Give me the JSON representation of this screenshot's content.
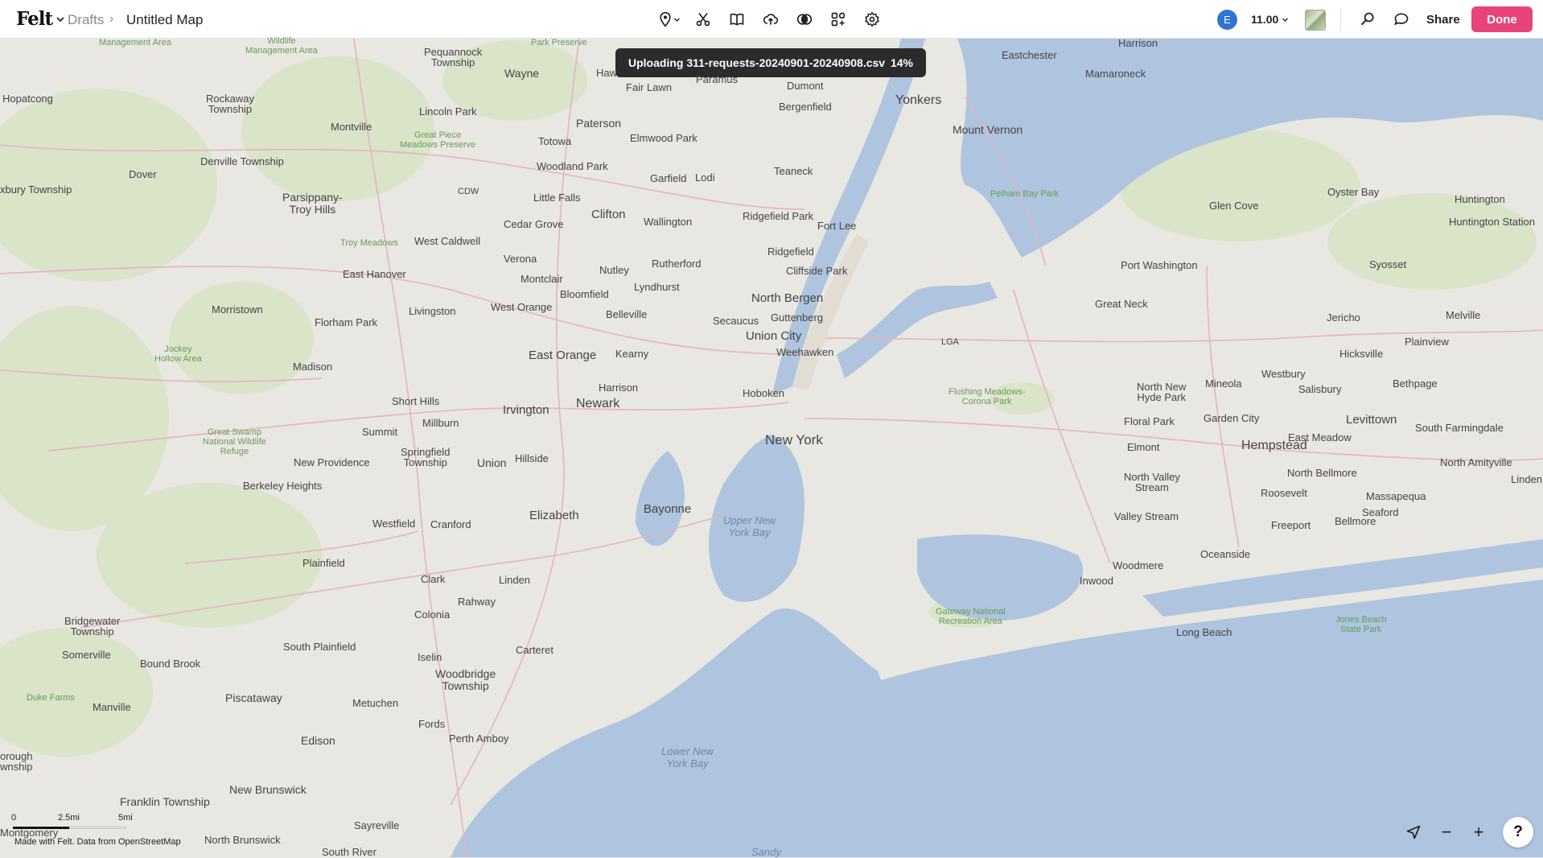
{
  "header": {
    "logo": "Felt",
    "breadcrumb_parent": "Drafts",
    "breadcrumb_sep": "›",
    "map_title": "Untitled Map",
    "avatar_initial": "E",
    "zoom_level": "11.00",
    "share_label": "Share",
    "done_label": "Done"
  },
  "toolbar": [
    {
      "name": "pin-tool",
      "icon": "map-pin-icon"
    },
    {
      "name": "route-tool",
      "icon": "scissors-icon"
    },
    {
      "name": "library-tool",
      "icon": "book-icon"
    },
    {
      "name": "upload-tool",
      "icon": "cloud-upload-icon"
    },
    {
      "name": "compare-tool",
      "icon": "circles-icon"
    },
    {
      "name": "elements-tool",
      "icon": "grid-plus-icon"
    },
    {
      "name": "settings-tool",
      "icon": "gear-icon"
    }
  ],
  "toast": {
    "text": "Uploading 311-requests-20240901-20240908.csv",
    "percent": "14%"
  },
  "map_labels": {
    "new_york": "New York",
    "newark": "Newark",
    "yonkers": "Yonkers",
    "mount_vernon": "Mount Vernon",
    "hempstead": "Hempstead",
    "levittown": "Levittown",
    "east_orange": "East Orange",
    "paterson": "Paterson",
    "clifton": "Clifton",
    "union_city": "Union City",
    "north_bergen": "North Bergen",
    "hoboken": "Hoboken",
    "elizabeth": "Elizabeth",
    "bayonne": "Bayonne",
    "irvington": "Irvington",
    "wayne": "Wayne",
    "lincoln_park": "Lincoln Park",
    "montville": "Montville",
    "denville": "Denville Township",
    "parsippany": "Parsippany-\nTroy Hills",
    "dover": "Dover",
    "morristown": "Morristown",
    "madison": "Madison",
    "florham_park": "Florham Park",
    "livingston": "Livingston",
    "east_hanover": "East Hanover",
    "west_caldwell": "West Caldwell",
    "verona": "Verona",
    "montclair": "Montclair",
    "bloomfield": "Bloomfield",
    "west_orange": "West Orange",
    "nutley": "Nutley",
    "lyndhurst": "Lyndhurst",
    "rutherford": "Rutherford",
    "belleville": "Belleville",
    "kearny": "Kearny",
    "harrison": "Harrison",
    "secaucus": "Secaucus",
    "guttenberg": "Guttenberg",
    "weehawken": "Weehawken",
    "cliffside_park": "Cliffside Park",
    "ridgefield": "Ridgefield",
    "ridgefield_park": "Ridgefield Park",
    "fort_lee": "Fort Lee",
    "teaneck": "Teaneck",
    "bergenfield": "Bergenfield",
    "dumont": "Dumont",
    "fair_lawn": "Fair Lawn",
    "elmwood_park": "Elmwood Park",
    "garfield": "Garfield",
    "lodi": "Lodi",
    "wallington": "Wallington",
    "totowa": "Totowa",
    "woodland_park": "Woodland Park",
    "little_falls": "Little Falls",
    "cedar_grove": "Cedar Grove",
    "pequannock": "Pequannock\nTownship",
    "rockaway": "Rockaway\nTownship",
    "hopatcong": "Hopatcong",
    "roxbury": "xbury Township",
    "short_hills": "Short Hills",
    "millburn": "Millburn",
    "summit": "Summit",
    "springfield": "Springfield\nTownship",
    "union": "Union",
    "hillside": "Hillside",
    "new_providence": "New Providence",
    "berkeley_heights": "Berkeley Heights",
    "westfield": "Westfield",
    "cranford": "Cranford",
    "plainfield": "Plainfield",
    "clark": "Clark",
    "linden": "Linden",
    "rahway": "Rahway",
    "colonia": "Colonia",
    "carteret": "Carteret",
    "iselin": "Iselin",
    "woodbridge": "Woodbridge\nTownship",
    "metuchen": "Metuchen",
    "fords": "Fords",
    "perth_amboy": "Perth Amboy",
    "edison": "Edison",
    "piscataway": "Piscataway",
    "south_plainfield": "South Plainfield",
    "bound_brook": "Bound Brook",
    "somerville": "Somerville",
    "bridgewater": "Bridgewater\nTownship",
    "manville": "Manville",
    "new_brunswick": "New Brunswick",
    "franklin_township": "Franklin Township",
    "sayreville": "Sayreville",
    "north_brunswick": "North Brunswick",
    "south_river": "South River",
    "hillsborough": "orough\nwnship",
    "montgomery": "Montgomery",
    "eastchester": "Eastchester",
    "mamaroneck": "Mamaroneck",
    "harrison_ny": "Harrison",
    "glen_cove": "Glen Cove",
    "oyster_bay": "Oyster Bay",
    "huntington": "Huntington",
    "huntington_station": "Huntington Station",
    "syosset": "Syosset",
    "port_washington": "Port Washington",
    "great_neck": "Great Neck",
    "jericho": "Jericho",
    "melville": "Melville",
    "plainview": "Plainview",
    "hicksville": "Hicksville",
    "westbury": "Westbury",
    "salisbury": "Salisbury",
    "mineola": "Mineola",
    "north_new_hyde_park": "North New\nHyde Park",
    "bethpage": "Bethpage",
    "garden_city": "Garden City",
    "floral_park": "Floral Park",
    "east_meadow": "East Meadow",
    "south_farmingdale": "South Farmingdale",
    "elmont": "Elmont",
    "north_valley_stream": "North Valley\nStream",
    "north_bellmore": "North Bellmore",
    "north_amityville": "North Amityville",
    "lindenhurst": "Linden",
    "roosevelt": "Roosevelt",
    "massapequa": "Massapequa",
    "seaford": "Seaford",
    "valley_stream": "Valley Stream",
    "freeport": "Freeport",
    "bellmore": "Bellmore",
    "oceanside": "Oceanside",
    "woodmere": "Woodmere",
    "inwood": "Inwood",
    "long_beach": "Long Beach",
    "lga": "LGA",
    "cdw": "CDW",
    "haw": "Haw",
    "paramus": "Paramus"
  },
  "park_labels": {
    "management_area_1": "Management Area",
    "management_area_2": "Wildlife\nManagement Area",
    "park_preserve": "Park Preserve",
    "great_piece": "Great Piece\nMeadows Preserve",
    "troy_meadows": "Troy Meadows",
    "jockey_hollow": "Jockey\nHollow Area",
    "great_swamp": "Great Swamp\nNational Wildlife\nRefuge",
    "duke_farms": "Duke Farms",
    "pelham_bay": "Pelham Bay Park",
    "flushing_meadows": "Flushing Meadows-\nCorona Park",
    "gateway": "Gateway National\nRecreation Area",
    "jones_beach": "Jones Beach\nState Park"
  },
  "water_labels": {
    "upper_bay": "Upper New\nYork Bay",
    "lower_bay": "Lower New\nYork Bay",
    "sandy": "Sandy"
  },
  "scale": {
    "zero": "0",
    "mid": "2.5mi",
    "end": "5mi"
  },
  "credit": "Made with Felt. Data from OpenStreetMap",
  "controls": {
    "locate_icon": "locate-arrow-icon",
    "zoom_out": "−",
    "zoom_in": "+",
    "help": "?"
  },
  "colors": {
    "land": "#e9e7e1",
    "park": "#d8e3c8",
    "water": "#aec4df",
    "road": "#e7b8c1",
    "accent": "#e8447a",
    "avatar": "#2f74d0"
  }
}
